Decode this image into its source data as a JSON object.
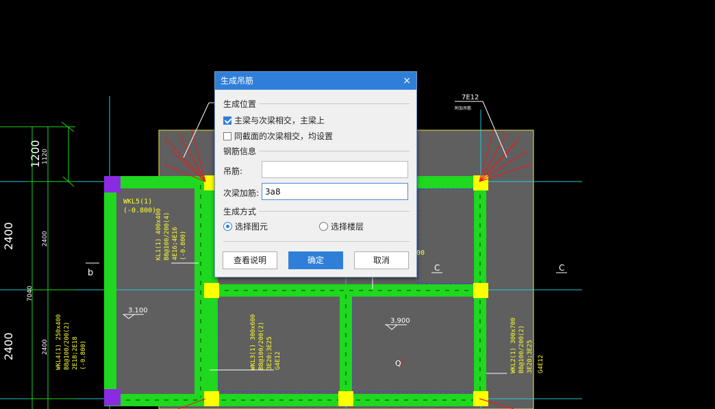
{
  "colors": {
    "titlebar": "#2f7fd8",
    "beam": "#1fd81f",
    "column": "#ffff00",
    "slab": "#5f5f5f",
    "text_yellow": "#ffff33"
  },
  "drawing": {
    "dims_left": [
      "1200",
      "2400",
      "2400"
    ],
    "dims_left_small": [
      "1120",
      "2400",
      "7040",
      "2400"
    ],
    "axis_labels": [
      "b",
      "C",
      "C",
      "Q"
    ],
    "elevations": [
      "3.100",
      "3.900"
    ],
    "rebar_tag": "7E12",
    "rebar_tag_sub": "附加吊筋",
    "beam_labels": {
      "wkl5": [
        "WKL5(1)",
        "(-0.800)"
      ],
      "kl1": [
        "KL1(1) 400x400",
        "B8@100/200(4)",
        "4E16;4E16",
        "(-0.800)"
      ],
      "wkl4": [
        "WKL4(1) 250x400",
        "B8@100/200(2)",
        "2E18;2E18",
        "(-0.800)"
      ],
      "wkl3": [
        "WKL3(1) 300x600",
        "B8@100/200(2)",
        "3E20;3E25",
        "G4E12"
      ],
      "wkl2": [
        "WKL2(1) 300x700",
        "B8@100/200(2)",
        "3E20;3E25",
        "G4E12"
      ],
      "hidden_tail": "00"
    }
  },
  "dialog": {
    "title": "生成吊筋",
    "close_glyph": "×",
    "section_position": "生成位置",
    "opt_main_beam": "主梁与次梁相交，主梁上",
    "opt_main_beam_checked": true,
    "opt_same_section": "同截面的次梁相交，均设置",
    "opt_same_section_checked": false,
    "section_rebar": "钢筋信息",
    "hanger_label": "吊筋:",
    "hanger_value": "",
    "secondary_label": "次梁加筋:",
    "secondary_value": "3a8",
    "section_method": "生成方式",
    "method_select_element": "选择图元",
    "method_select_floor": "选择楼层",
    "method_selected": "选择图元",
    "btn_help": "查看说明",
    "btn_ok": "确定",
    "btn_cancel": "取消"
  }
}
